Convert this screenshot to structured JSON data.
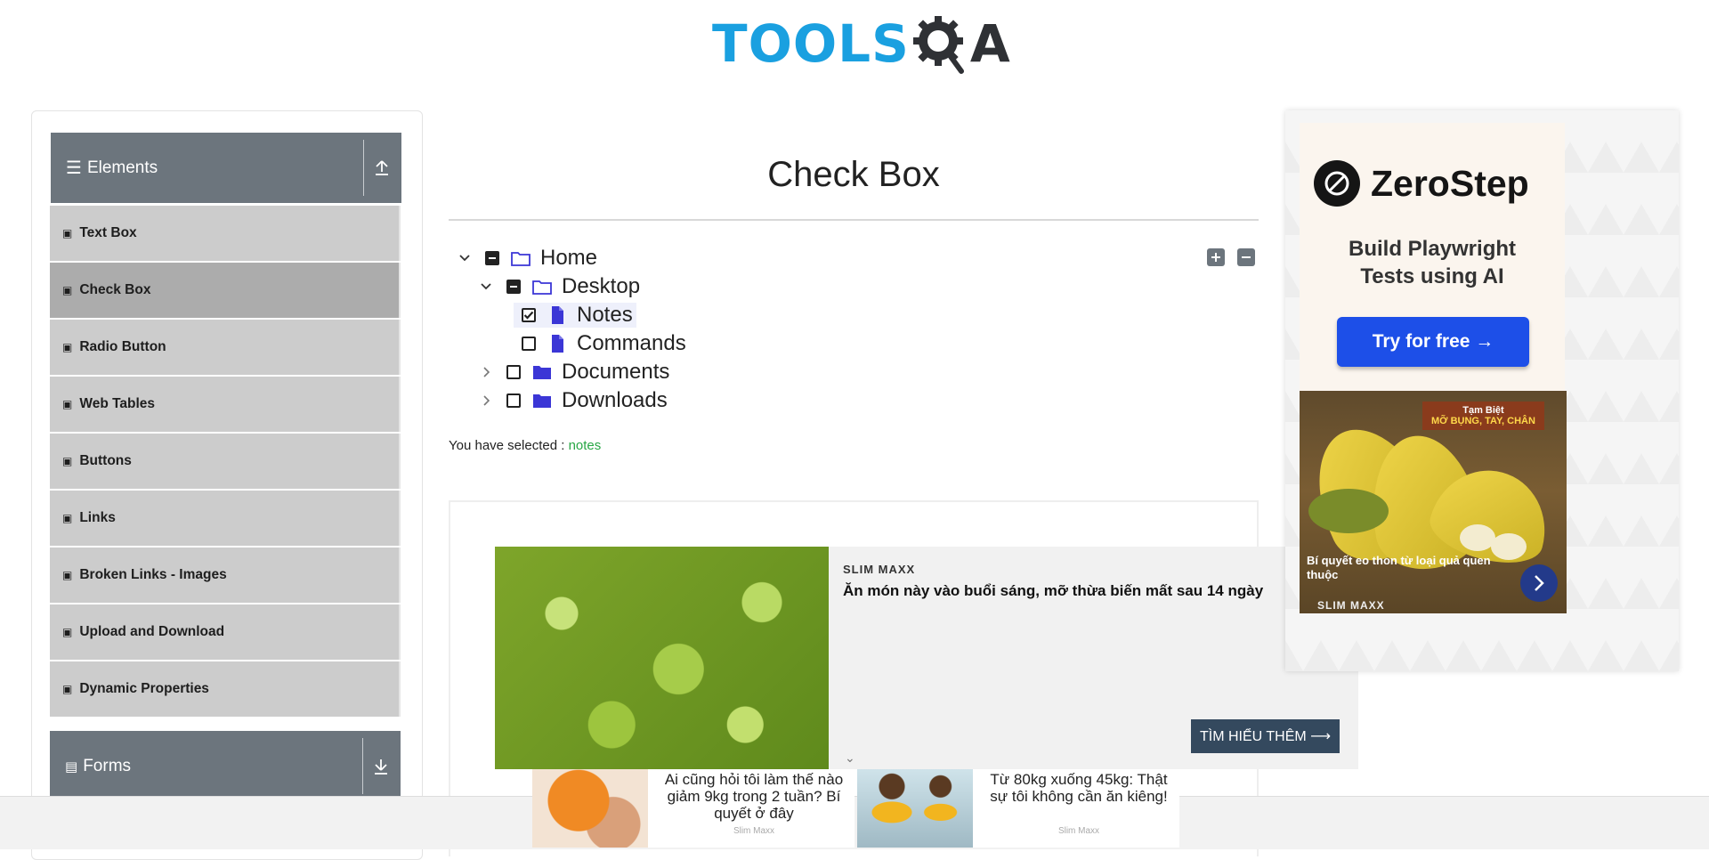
{
  "header": {
    "logo_text_a": "TOOLS",
    "logo_text_b": "A"
  },
  "sidebar": {
    "elements_label": "Elements",
    "forms_label": "Forms",
    "items": [
      {
        "label": "Text Box"
      },
      {
        "label": "Check Box"
      },
      {
        "label": "Radio Button"
      },
      {
        "label": "Web Tables"
      },
      {
        "label": "Buttons"
      },
      {
        "label": "Links"
      },
      {
        "label": "Broken Links - Images"
      },
      {
        "label": "Upload and Download"
      },
      {
        "label": "Dynamic Properties"
      }
    ],
    "active_item": "Check Box"
  },
  "main": {
    "title": "Check Box",
    "tree": {
      "home": {
        "label": "Home",
        "state": "partial",
        "expanded": true
      },
      "desktop": {
        "label": "Desktop",
        "state": "partial",
        "expanded": true
      },
      "notes": {
        "label": "Notes",
        "state": "checked"
      },
      "commands": {
        "label": "Commands",
        "state": "unchecked"
      },
      "documents": {
        "label": "Documents",
        "state": "unchecked",
        "expanded": false
      },
      "downloads": {
        "label": "Downloads",
        "state": "unchecked",
        "expanded": false
      }
    },
    "result_prefix": "You have selected :",
    "result_value": "notes"
  },
  "native_ad": {
    "brand": "SLIM MAXX",
    "title": "Ăn món này vào buổi sáng, mỡ thừa biến mất sau 14 ngày",
    "cta": "TÌM HIỂU THÊM ⟶"
  },
  "right_ad": {
    "brand": "ZeroStep",
    "tagline_1": "Build Playwright",
    "tagline_2": "Tests using AI",
    "cta": "Try for free →",
    "sub_badge_1": "Tạm Biệt",
    "sub_badge_2": "MỠ BỤNG, TAY, CHÂN",
    "sub_caption": "Bí quyết eo thon từ loại quả quen thuộc",
    "sub_brand": "SLIM MAXX"
  },
  "bottom_ads": [
    {
      "text": "Ai cũng hỏi tôi làm thế nào giảm 9kg trong 2 tuần? Bí quyết ở đây",
      "brand": "Slim Maxx"
    },
    {
      "text": "Từ 80kg xuống 45kg: Thật sự tôi không cần ăn kiêng!",
      "brand": "Slim Maxx"
    }
  ],
  "colors": {
    "accent_blue": "#1aa0e0",
    "sidebar_header": "#6c757d",
    "selected_text": "#28a745",
    "folder_blue": "#3b36d6"
  }
}
